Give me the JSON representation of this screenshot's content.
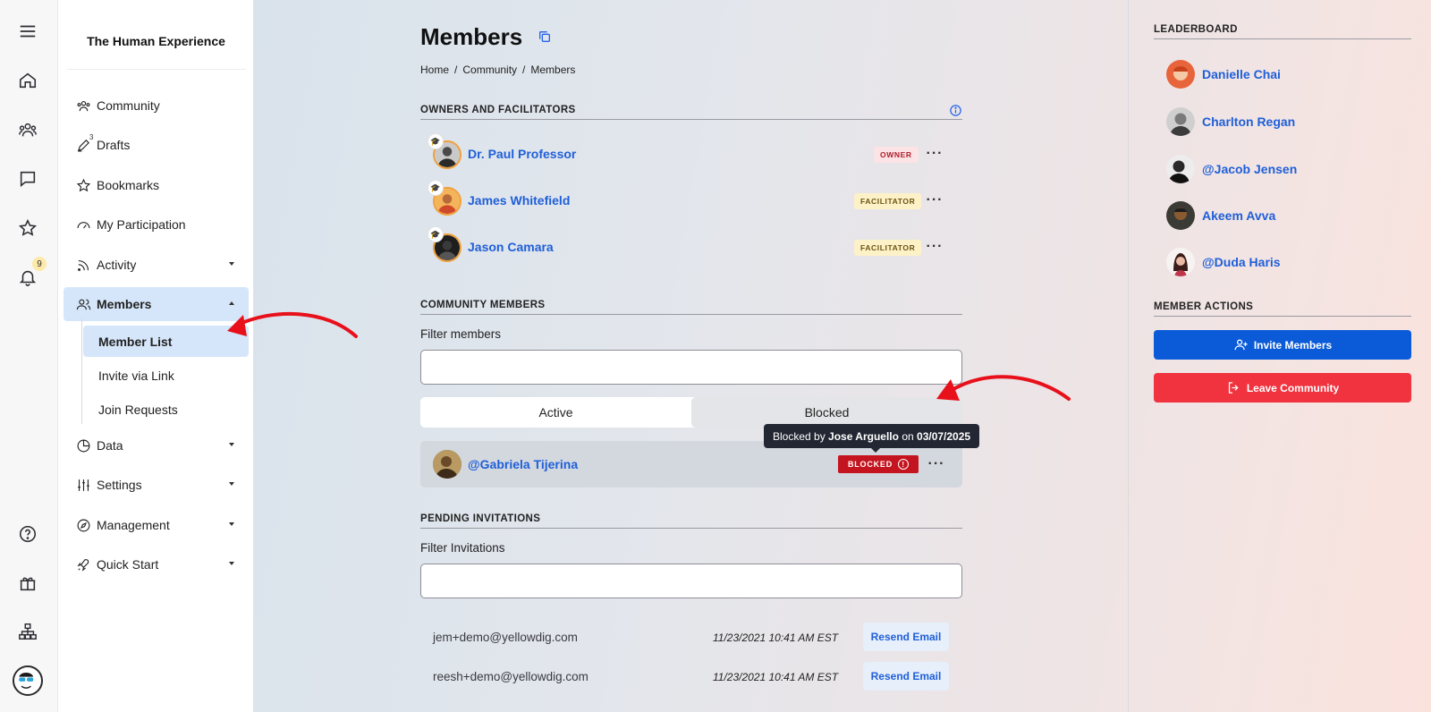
{
  "community_name": "The Human Experience",
  "rail": {
    "notification_count": "9"
  },
  "nav": {
    "drafts_count": "3",
    "items": [
      {
        "label": "Community"
      },
      {
        "label": "Drafts"
      },
      {
        "label": "Bookmarks"
      },
      {
        "label": "My Participation"
      },
      {
        "label": "Activity"
      },
      {
        "label": "Members"
      },
      {
        "label": "Data"
      },
      {
        "label": "Settings"
      },
      {
        "label": "Management"
      },
      {
        "label": "Quick Start"
      }
    ],
    "members_sub": [
      {
        "label": "Member List"
      },
      {
        "label": "Invite via Link"
      },
      {
        "label": "Join Requests"
      }
    ]
  },
  "page": {
    "title": "Members",
    "breadcrumb": [
      "Home",
      "Community",
      "Members"
    ]
  },
  "owners": {
    "heading": "OWNERS AND FACILITATORS",
    "list": [
      {
        "name": "Dr. Paul Professor",
        "role": "OWNER"
      },
      {
        "name": "James Whitefield",
        "role": "FACILITATOR"
      },
      {
        "name": "Jason Camara",
        "role": "FACILITATOR"
      }
    ]
  },
  "community_members": {
    "heading": "COMMUNITY MEMBERS",
    "filter_label": "Filter members",
    "tabs": [
      "Active",
      "Blocked"
    ],
    "member": {
      "name": "@Gabriela Tijerina",
      "status": "BLOCKED"
    },
    "tooltip": {
      "prefix": "Blocked by",
      "by": "Jose Arguello",
      "on": "on",
      "date": "03/07/2025"
    }
  },
  "pending": {
    "heading": "PENDING INVITATIONS",
    "filter_label": "Filter Invitations",
    "invitations": [
      {
        "email": "jem+demo@yellowdig.com",
        "date": "11/23/2021 10:41 AM EST",
        "action": "Resend Email"
      },
      {
        "email": "reesh+demo@yellowdig.com",
        "date": "11/23/2021 10:41 AM EST",
        "action": "Resend Email"
      }
    ]
  },
  "leaderboard": {
    "heading": "LEADERBOARD",
    "people": [
      {
        "name": "Danielle Chai"
      },
      {
        "name": "Charlton Regan"
      },
      {
        "name": "@Jacob Jensen"
      },
      {
        "name": "Akeem Avva"
      },
      {
        "name": "@Duda Haris"
      }
    ]
  },
  "member_actions": {
    "heading": "MEMBER ACTIONS",
    "invite": "Invite Members",
    "leave": "Leave Community"
  },
  "colors": {
    "link_blue": "#1f5fd8",
    "primary_button": "#0b5bd9",
    "danger_button": "#f0333f",
    "blocked_badge": "#c4141f",
    "annotation_arrow": "#e8101a"
  }
}
